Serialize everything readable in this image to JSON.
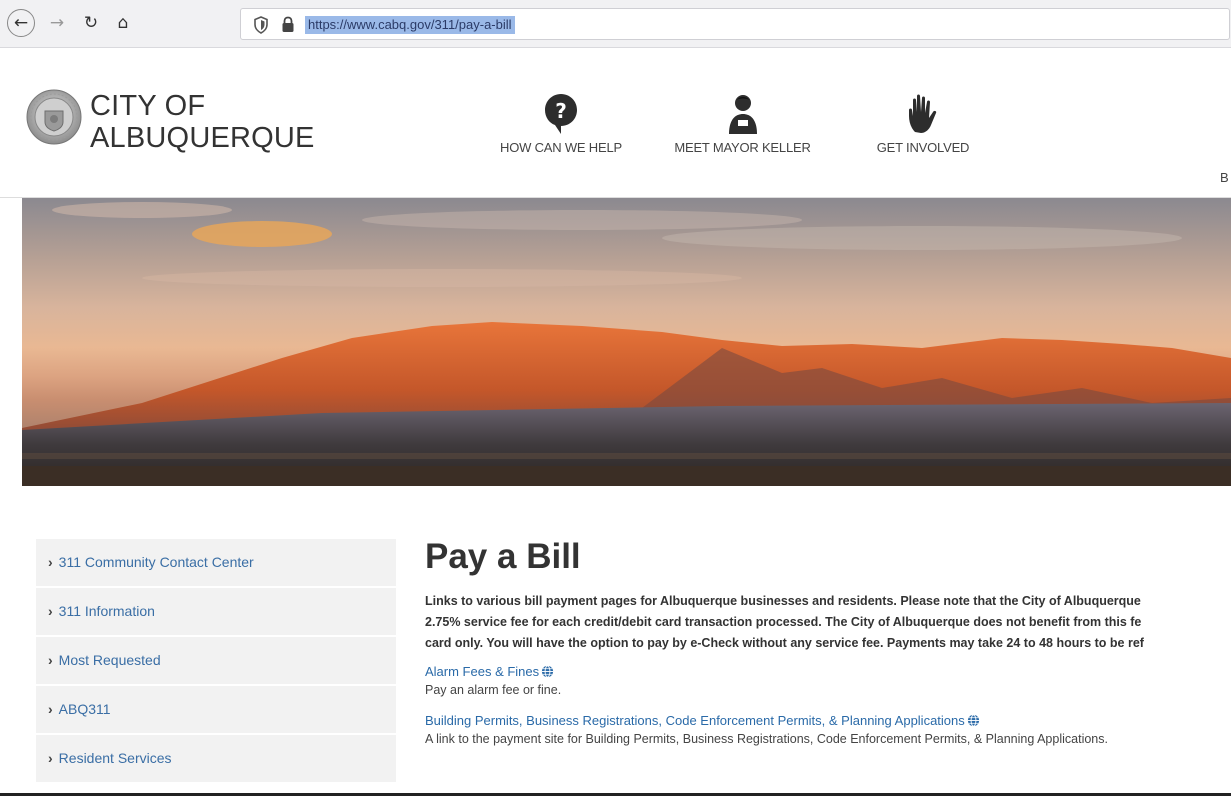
{
  "browser": {
    "url": "https://www.cabq.gov/311/pay-a-bill",
    "icons": [
      "back-icon",
      "forward-icon",
      "reload-icon",
      "home-icon",
      "shield-icon",
      "lock-icon"
    ]
  },
  "header": {
    "logo_line1": "CITY OF",
    "logo_line2": "ALBUQUERQUE",
    "nav": [
      {
        "label": "HOW CAN WE HELP",
        "icon": "question-icon"
      },
      {
        "label": "MEET MAYOR KELLER",
        "icon": "person-icon"
      },
      {
        "label": "GET INVOLVED",
        "icon": "hand-icon"
      }
    ],
    "cutoff_letter": "B"
  },
  "sidebar": {
    "items": [
      {
        "label": "311 Community Contact Center"
      },
      {
        "label": "311 Information"
      },
      {
        "label": "Most Requested"
      },
      {
        "label": "ABQ311"
      },
      {
        "label": "Resident Services"
      }
    ]
  },
  "main": {
    "title": "Pay a Bill",
    "intro_lines": [
      "Links to various bill payment pages for Albuquerque businesses and residents. Please note that the City of Albuquerque",
      "2.75% service fee for each credit/debit card transaction processed. The City of Albuquerque does not benefit from this fe",
      "card only. You will have the option to pay by e-Check without any service fee. Payments may take 24 to 48 hours to be ref"
    ],
    "links": [
      {
        "label": "Alarm Fees & Fines",
        "desc": "Pay an alarm fee or fine."
      },
      {
        "label": "Building Permits, Business Registrations, Code Enforcement Permits, & Planning Applications",
        "desc": "A link to the payment site for Building Permits, Business Registrations, Code Enforcement Permits, & Planning Applications."
      }
    ]
  },
  "colors": {
    "link": "#2a6aa8",
    "sidebar_bg": "#f2f2f2",
    "url_highlight": "#9ab9e8"
  }
}
